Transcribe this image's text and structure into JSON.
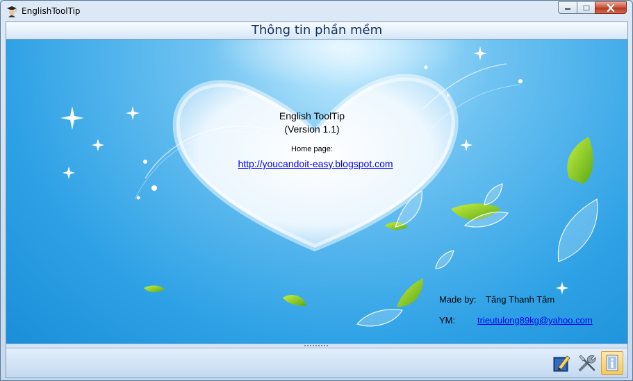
{
  "window": {
    "title": "EnglishToolTip"
  },
  "header": {
    "title": "Thông tin phần mềm"
  },
  "about": {
    "app_name": "English ToolTip",
    "version": "(Version 1.1)",
    "home_label": "Home page:",
    "home_url": "http://youcandoit-easy.blogspot.com",
    "made_by_label": "Made by:",
    "made_by_value": "Tăng Thanh Tâm",
    "ym_label": "YM:",
    "ym_value": "trieutulong89kg@yahoo.com"
  },
  "toolbar": {
    "buttons": [
      {
        "icon": "pen-edit-icon"
      },
      {
        "icon": "tools-icon"
      },
      {
        "icon": "info-icon"
      }
    ]
  },
  "colors": {
    "link": "#0000ee",
    "header_text": "#0e2f5e",
    "sky": "#2fa2e6",
    "close_button": "#c7513a"
  }
}
